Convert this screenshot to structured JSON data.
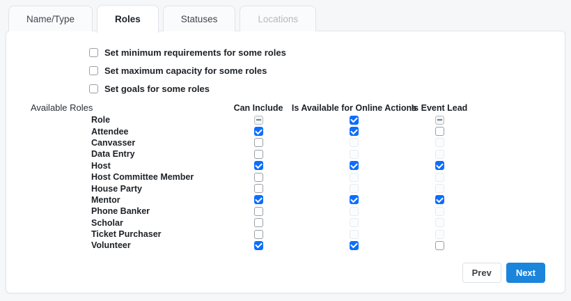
{
  "tabs": [
    {
      "label": "Name/Type",
      "state": "inactive"
    },
    {
      "label": "Roles",
      "state": "active"
    },
    {
      "label": "Statuses",
      "state": "inactive"
    },
    {
      "label": "Locations",
      "state": "disabled"
    }
  ],
  "options": [
    {
      "label": "Set minimum requirements for some roles",
      "checked": false
    },
    {
      "label": "Set maximum capacity for some roles",
      "checked": false
    },
    {
      "label": "Set goals for some roles",
      "checked": false
    }
  ],
  "roles_section": {
    "label": "Available Roles",
    "columns": [
      "Can Include",
      "Is Available for Online Actions",
      "Is Event Lead"
    ],
    "rows": [
      {
        "name": "Role",
        "can_include": "indeterminate",
        "online_actions": "checked",
        "event_lead": "indeterminate"
      },
      {
        "name": "Attendee",
        "can_include": "checked",
        "online_actions": "checked",
        "event_lead": "unchecked"
      },
      {
        "name": "Canvasser",
        "can_include": "unchecked",
        "online_actions": "disabled",
        "event_lead": "disabled"
      },
      {
        "name": "Data Entry",
        "can_include": "unchecked",
        "online_actions": "disabled",
        "event_lead": "disabled"
      },
      {
        "name": "Host",
        "can_include": "checked",
        "online_actions": "checked",
        "event_lead": "checked"
      },
      {
        "name": "Host Committee Member",
        "can_include": "unchecked",
        "online_actions": "disabled",
        "event_lead": "disabled"
      },
      {
        "name": "House Party",
        "can_include": "unchecked",
        "online_actions": "disabled",
        "event_lead": "disabled"
      },
      {
        "name": "Mentor",
        "can_include": "checked",
        "online_actions": "checked",
        "event_lead": "checked"
      },
      {
        "name": "Phone Banker",
        "can_include": "unchecked",
        "online_actions": "disabled",
        "event_lead": "disabled"
      },
      {
        "name": "Scholar",
        "can_include": "unchecked",
        "online_actions": "disabled",
        "event_lead": "disabled"
      },
      {
        "name": "Ticket Purchaser",
        "can_include": "unchecked",
        "online_actions": "disabled",
        "event_lead": "disabled"
      },
      {
        "name": "Volunteer",
        "can_include": "checked",
        "online_actions": "checked",
        "event_lead": "unchecked"
      }
    ]
  },
  "footer": {
    "prev_label": "Prev",
    "next_label": "Next"
  },
  "colors": {
    "checkbox_checked": "#0d6efd",
    "next_button": "#1b84db",
    "page_background": "#f6f7f9",
    "panel_border": "#e2e6ea"
  }
}
